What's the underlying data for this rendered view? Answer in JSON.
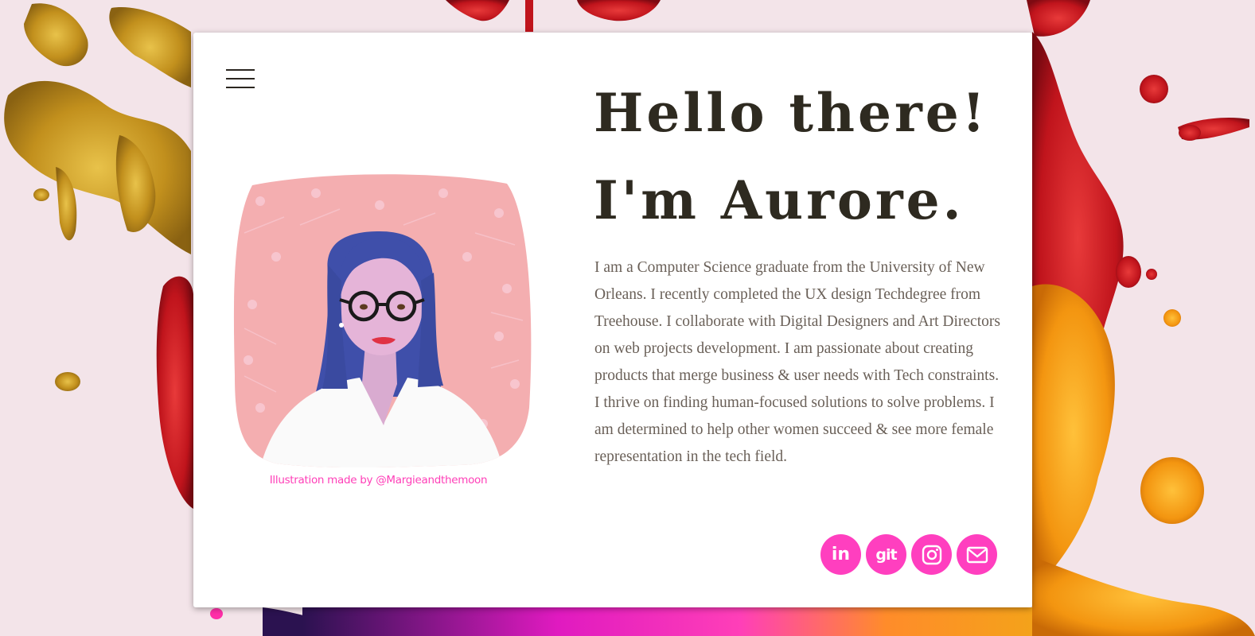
{
  "nav": {
    "menu_icon": "hamburger-menu-icon"
  },
  "hero": {
    "greeting_line1": "Hello there!",
    "greeting_line2": "I'm Aurore.",
    "bio": "I am a Computer Science graduate from the University of New Orleans. I recently completed the UX design Techdegree from Treehouse. I collaborate with Digital Designers and Art Directors on web projects development. I am passionate about creating products that merge business & user needs with Tech constraints. I thrive on finding human-focused solutions to solve problems. I am determined to help other women succeed & see more female representation in the tech field."
  },
  "portrait": {
    "credit": "Illustration made by @Margieandthemoon"
  },
  "socials": [
    {
      "icon": "linkedin-icon",
      "label": "in"
    },
    {
      "icon": "github-icon",
      "label": "git"
    },
    {
      "icon": "instagram-icon",
      "label": ""
    },
    {
      "icon": "email-icon",
      "label": ""
    }
  ],
  "colors": {
    "accent": "#ff3fbf",
    "heading": "#2e2a20",
    "body_text": "#6a6058",
    "card": "#ffffff"
  }
}
